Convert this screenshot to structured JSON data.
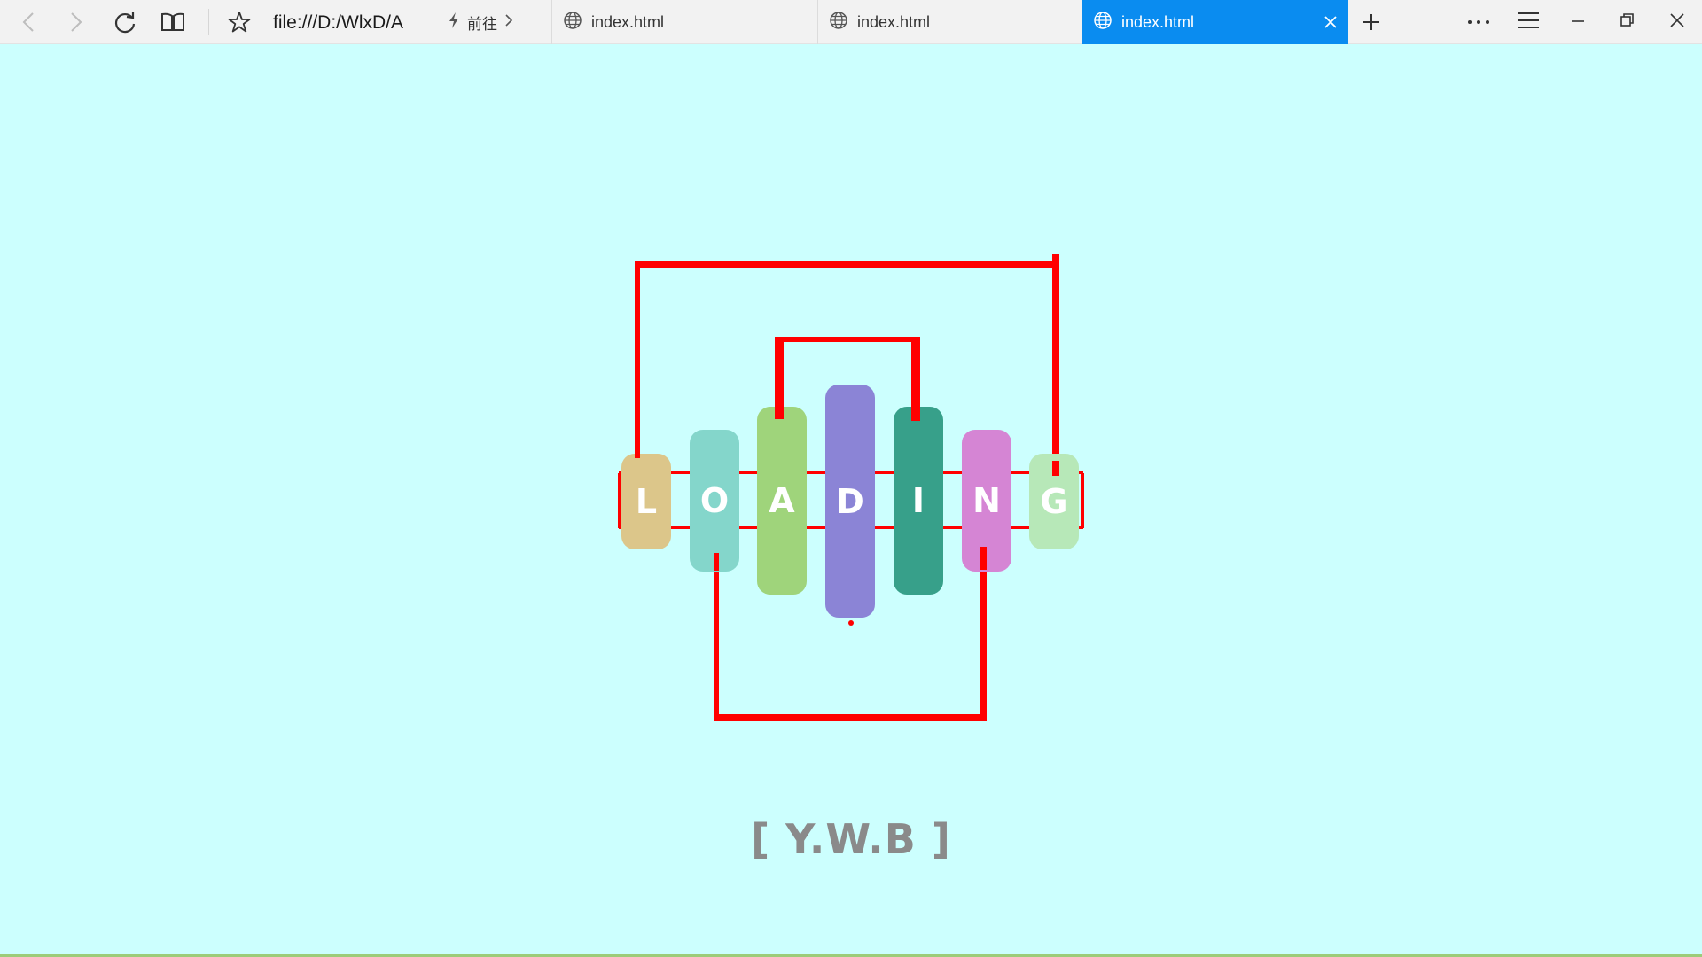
{
  "browser": {
    "address_text": "file:///D:/WlxD/A",
    "goto_label": "前往",
    "tabs": [
      {
        "label": "index.html",
        "active": false
      },
      {
        "label": "index.html",
        "active": false
      },
      {
        "label": "index.html",
        "active": true
      }
    ],
    "icons": {
      "back": "back-arrow-icon",
      "forward": "forward-arrow-icon",
      "refresh": "refresh-icon",
      "reading_view": "book-icon",
      "favorite": "star-icon",
      "goto": "lightning-icon",
      "tab": "globe-icon",
      "new_tab": "plus-icon",
      "more": "ellipsis-icon",
      "hub": "hamburger-icon",
      "minimize": "minimize-icon",
      "restore": "restore-icon",
      "close": "close-icon"
    },
    "accent_color": "#0a8cf0"
  },
  "page": {
    "background_color": "#ccfffe",
    "wire_color": "#ff0000",
    "letters": [
      {
        "char": "L",
        "color": "#dcc68a"
      },
      {
        "char": "O",
        "color": "#84d6cb"
      },
      {
        "char": "A",
        "color": "#9fd47b"
      },
      {
        "char": "D",
        "color": "#8b84d6"
      },
      {
        "char": "I",
        "color": "#37a08a"
      },
      {
        "char": "N",
        "color": "#d585d4"
      },
      {
        "char": "G",
        "color": "#b7e8b8"
      }
    ],
    "credit": "[ Y.W.B ]",
    "credit_color": "#8a8a8a"
  }
}
